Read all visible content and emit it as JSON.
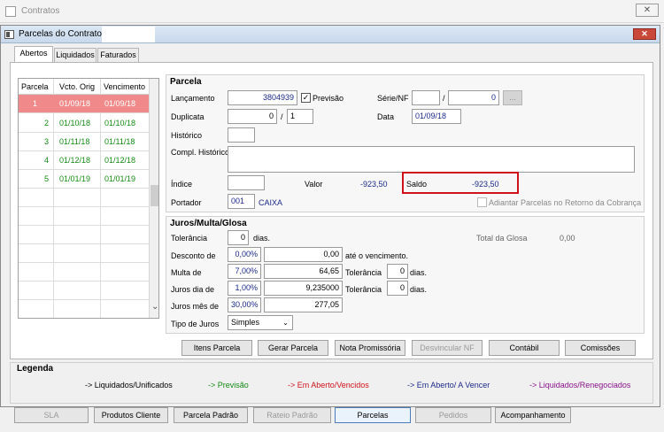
{
  "outer_window": {
    "title": "Contratos",
    "close": "✕"
  },
  "inner_window": {
    "title": "Parcelas do Contrato -",
    "close": "✕"
  },
  "tabs": [
    "Abertos",
    "Liquidados",
    "Faturados"
  ],
  "grid": {
    "headers": [
      "Parcela",
      "Vcto. Orig",
      "Vencimento"
    ],
    "rows": [
      {
        "parcela": "1",
        "orig": "01/09/18",
        "venc": "01/09/18"
      },
      {
        "parcela": "2",
        "orig": "01/10/18",
        "venc": "01/10/18"
      },
      {
        "parcela": "3",
        "orig": "01/11/18",
        "venc": "01/11/18"
      },
      {
        "parcela": "4",
        "orig": "01/12/18",
        "venc": "01/12/18"
      },
      {
        "parcela": "5",
        "orig": "01/01/19",
        "venc": "01/01/19"
      }
    ],
    "scroll_arrow": "⌄"
  },
  "parcela": {
    "title": "Parcela",
    "lancamento_label": "Lançamento",
    "lancamento_value": "3804939",
    "previsao_label": "Previsão",
    "previsao_check": "✓",
    "serie_label": "Série/NF",
    "serie_value": "",
    "slash": "/",
    "nf_value": "0",
    "nf_btn": "...",
    "duplicata_label": "Duplicata",
    "duplicata_value": "0",
    "duplicata_seq": "1",
    "data_label": "Data",
    "data_value": "01/09/18",
    "historico_label": "Histórico",
    "compl_label": "Compl. Histórico",
    "indice_label": "Índice",
    "valor_label": "Valor",
    "valor_value": "-923,50",
    "saldo_label": "Saldo",
    "saldo_value": "-923,50",
    "portador_label": "Portador",
    "portador_code": "001",
    "portador_name": "CAIXA",
    "adiantar_label": "Adiantar Parcelas no Retorno da Cobrança"
  },
  "juros": {
    "title": "Juros/Multa/Glosa",
    "tolerancia_label": "Tolerância",
    "tolerancia_value": "0",
    "dias": "dias.",
    "total_glosa_label": "Total da Glosa",
    "total_glosa_value": "0,00",
    "desconto_label": "Desconto de",
    "desconto_pct": "0,00%",
    "desconto_val": "0,00",
    "ate_venc": "até o vencimento.",
    "multa_label": "Multa de",
    "multa_pct": "7,00%",
    "multa_val": "64,65",
    "multa_tol_label": "Tolerância",
    "multa_tol_val": "0",
    "multa_dias": "dias.",
    "jurosdia_label": "Juros dia de",
    "jurosdia_pct": "1,00%",
    "jurosdia_val": "9,235000",
    "jurosdia_tol_label": "Tolerância",
    "jurosdia_tol_val": "0",
    "jurosdia_dias": "dias.",
    "jurosmes_label": "Juros mês de",
    "jurosmes_pct": "30,00%",
    "jurosmes_val": "277,05",
    "tipo_label": "Tipo de Juros",
    "tipo_value": "Simples"
  },
  "actions": [
    "Itens Parcela",
    "Gerar Parcela",
    "Nota Promissória",
    "Desvincular NF",
    "Contábil",
    "Comissões"
  ],
  "legenda": {
    "title": "Legenda",
    "items": [
      {
        "text": "-> Liquidados/Unificados",
        "color": "#000000"
      },
      {
        "text": "-> Previsão",
        "color": "#148a14"
      },
      {
        "text": "-> Em Aberto/Vencidos",
        "color": "#d0121a"
      },
      {
        "text": "-> Em Aberto/ A Vencer",
        "color": "#1c2a8a"
      },
      {
        "text": "-> Liquidados/Renegociados",
        "color": "#8a148a"
      }
    ]
  },
  "bottom_tabs": [
    "SLA",
    "Produtos Cliente",
    "Parcela Padrão",
    "Rateio Padrão",
    "Parcelas",
    "Pedidos",
    "Acompanhamento"
  ]
}
